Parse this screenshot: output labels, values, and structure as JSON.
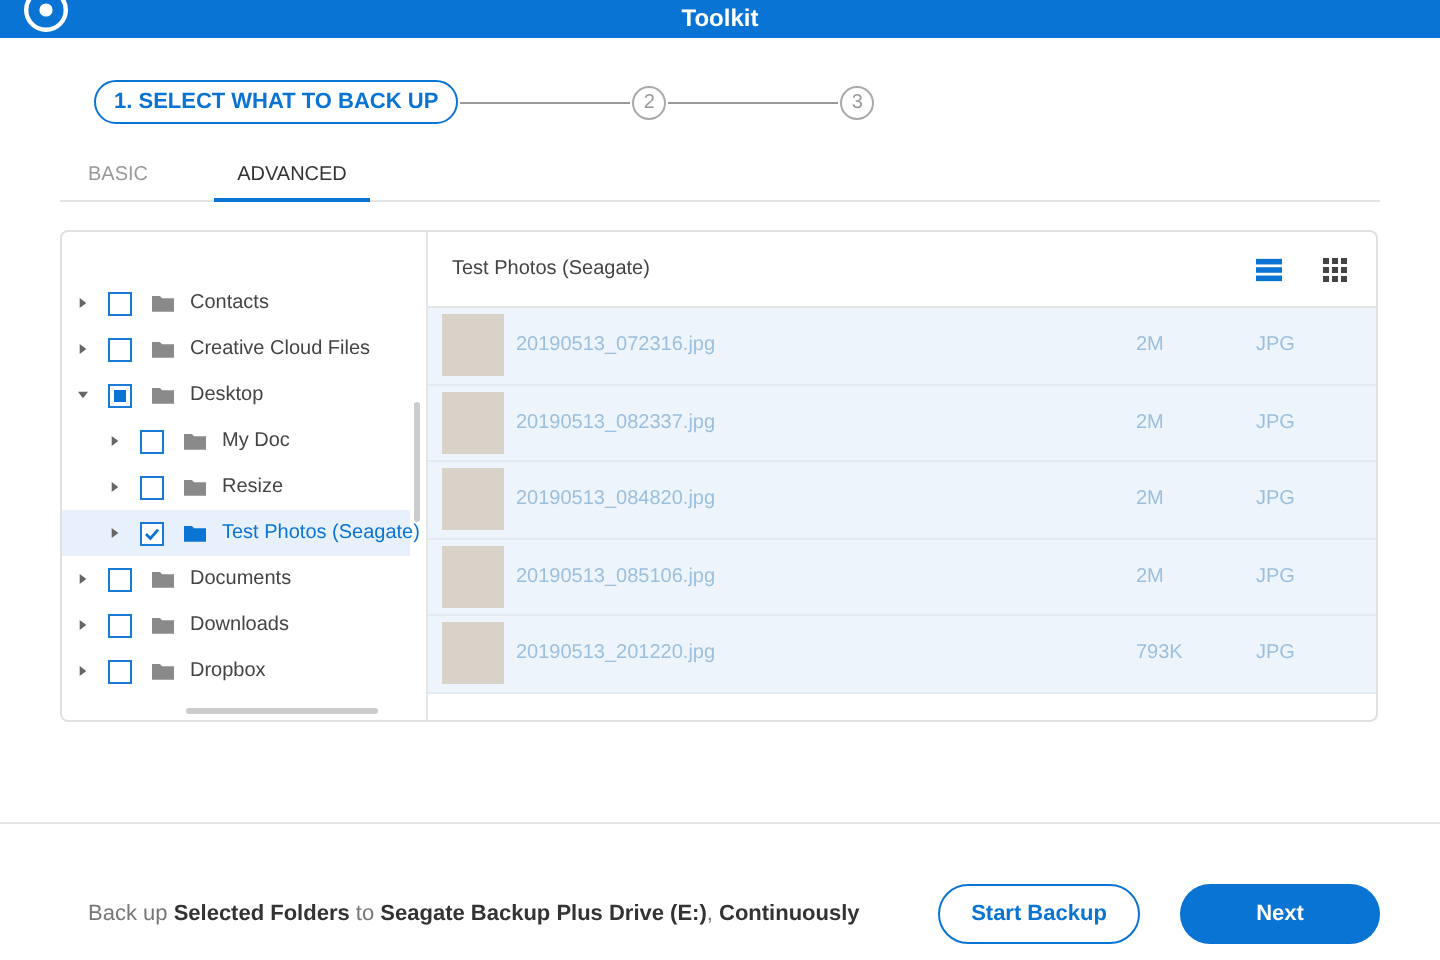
{
  "window": {
    "title": "Toolkit"
  },
  "steps": [
    {
      "label": "1. SELECT WHAT TO BACK UP",
      "selected": true
    },
    {
      "label": "2",
      "selected": false
    },
    {
      "label": "3",
      "selected": false
    }
  ],
  "tabs": [
    {
      "label": "BASIC",
      "selected": false
    },
    {
      "label": "ADVANCED",
      "selected": true
    }
  ],
  "tree": [
    {
      "label": "Contacts",
      "checked": false,
      "partial": false,
      "selected": false,
      "expanded": false
    },
    {
      "label": "Creative Cloud Files",
      "checked": false,
      "partial": false,
      "selected": false,
      "expanded": false
    },
    {
      "label": "Desktop",
      "checked": false,
      "partial": true,
      "selected": false,
      "expanded": true,
      "children": [
        {
          "label": "My Doc",
          "checked": false,
          "partial": false,
          "selected": false,
          "expanded": false
        },
        {
          "label": "Resize",
          "checked": false,
          "partial": false,
          "selected": false,
          "expanded": false
        },
        {
          "label": "Test Photos (Seagate)",
          "checked": true,
          "partial": false,
          "selected": true,
          "expanded": false
        }
      ]
    },
    {
      "label": "Documents",
      "checked": false,
      "partial": false,
      "selected": false,
      "expanded": false
    },
    {
      "label": "Downloads",
      "checked": false,
      "partial": false,
      "selected": false,
      "expanded": false
    },
    {
      "label": "Dropbox",
      "checked": false,
      "partial": false,
      "selected": false,
      "expanded": false
    }
  ],
  "file_list": {
    "title": "Test Photos (Seagate)",
    "views": [
      {
        "kind": "list",
        "selected": true
      },
      {
        "kind": "grid",
        "selected": false
      }
    ],
    "files": [
      {
        "name": "20190513_072316.jpg",
        "size": "2M",
        "type": "JPG"
      },
      {
        "name": "20190513_082337.jpg",
        "size": "2M",
        "type": "JPG"
      },
      {
        "name": "20190513_084820.jpg",
        "size": "2M",
        "type": "JPG"
      },
      {
        "name": "20190513_085106.jpg",
        "size": "2M",
        "type": "JPG"
      },
      {
        "name": "20190513_201220.jpg",
        "size": "793K",
        "type": "JPG"
      }
    ]
  },
  "footer": {
    "summary": "Back up **Selected Folders** to **Seagate Backup Plus Drive (E:)**, **Continuously**",
    "buttons": [
      {
        "label": "Start Backup",
        "kind": "outline"
      },
      {
        "label": "Next",
        "kind": "primary"
      }
    ]
  }
}
